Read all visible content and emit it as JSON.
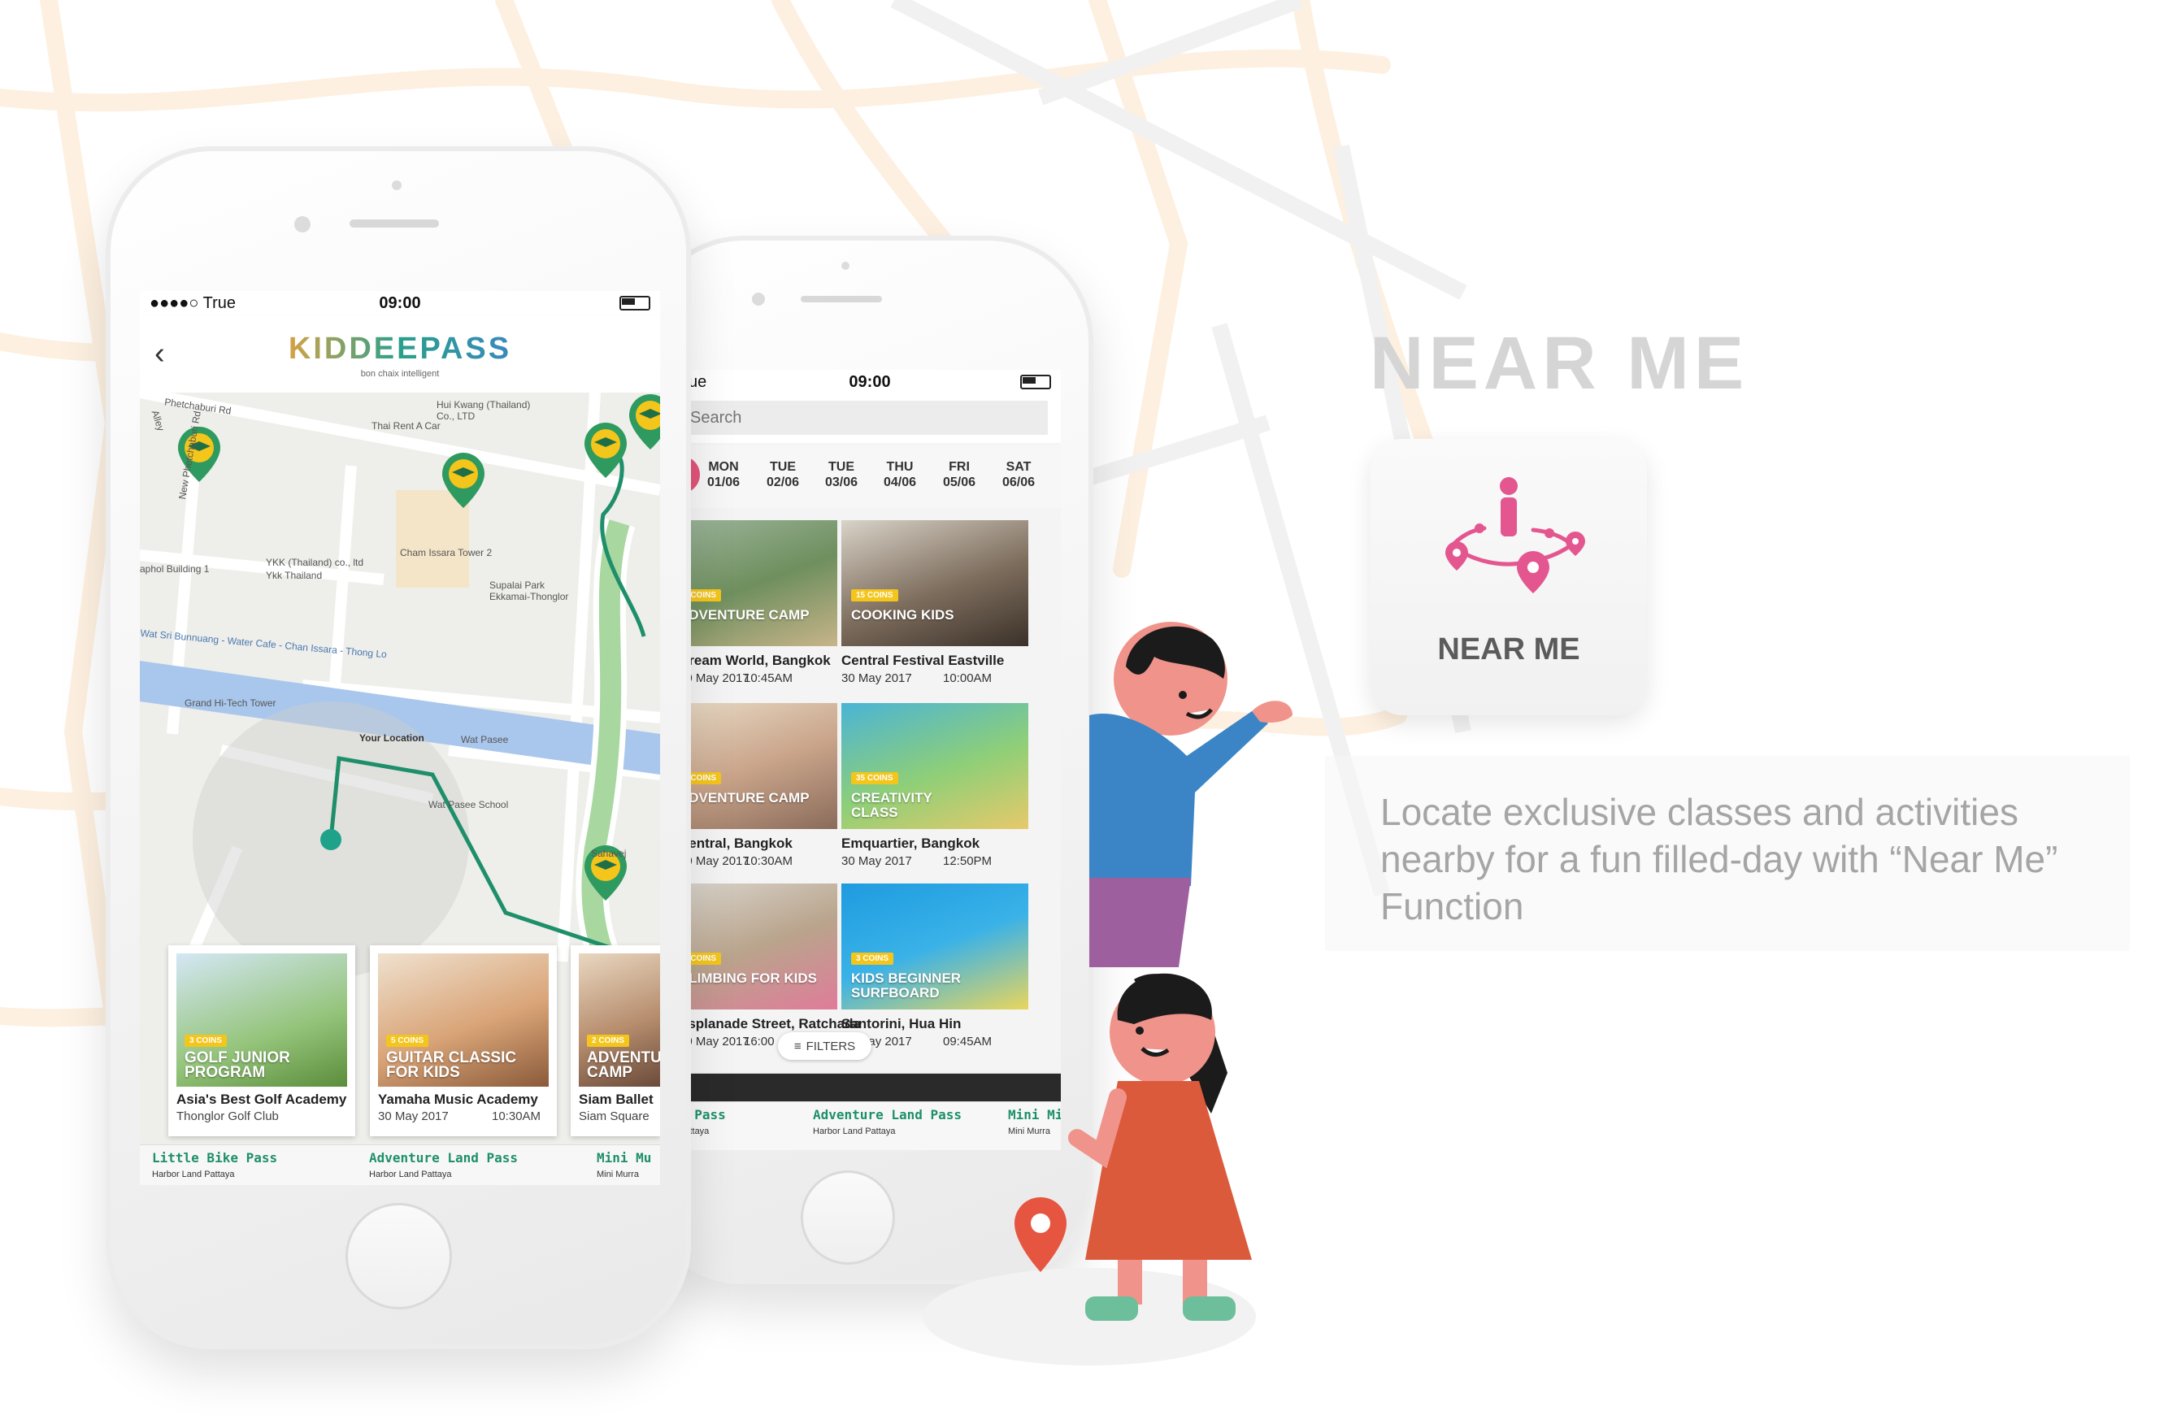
{
  "headline": "NEAR ME",
  "feature": {
    "label": "NEAR ME",
    "icon": "near-me-location-icon"
  },
  "description": "Locate exclusive classes and activities nearby for a fun filled-day with “Near Me” Function",
  "colors": {
    "brand_green": "#1e8f6a",
    "pin_green": "#2e9a5f",
    "coins_yellow": "#f4c51b",
    "near_me_pink": "#e4568f",
    "headline_gray": "#d5d5d5"
  },
  "phone_left": {
    "status": {
      "carrier": "●●●●○ True",
      "time": "09:00"
    },
    "header": {
      "logo": "KIDDEEPASS",
      "tagline": "bon chaix intelligent",
      "back_icon": "chevron-left-icon"
    },
    "map_labels": {
      "road1": "Phetchaburi Rd",
      "road2": "New Phetchaburi Rd",
      "road3": "Alley",
      "place1": "Thai Rent A Car",
      "place2": "Hui Kwang (Thailand) Co., LTD",
      "place3": "YKK (Thailand) co., ltd",
      "place4": "Ykk Thailand",
      "place5": "Cham Issara Tower 2",
      "place6": "Supalai Park Ekkamai-Thonglor",
      "place7": "Grand Hi-Tech Tower",
      "place8": "Your Location",
      "place9": "Wat Pasee",
      "place10": "Wat Pasee School",
      "place11": "aphol Building 1",
      "place12": "Wat Sri Bunnuang - Water Cafe - Chan Issara - Thong Lo",
      "place13": "Sahavej"
    },
    "cards": [
      {
        "coins": "3 COINS",
        "title": "GOLF JUNIOR PROGRAM",
        "venue": "Asia's Best Golf Academy",
        "sub": "Thonglor Golf Club"
      },
      {
        "coins": "5 COINS",
        "title": "GUITAR CLASSIC FOR KIDS",
        "venue": "Yamaha Music Academy",
        "sub": "30 May 2017",
        "time": "10:30AM"
      },
      {
        "coins": "2 COINS",
        "title": "ADVENTU CAMP",
        "venue": "Siam Ballet",
        "sub": "Siam Square"
      }
    ],
    "strip": [
      {
        "title": "Little Bike Pass",
        "sub": "Harbor Land Pattaya"
      },
      {
        "title": "Adventure Land Pass",
        "sub": "Harbor Land Pattaya"
      },
      {
        "title": "Mini Mu",
        "sub": "Mini Murra"
      }
    ]
  },
  "phone_right": {
    "status": {
      "carrier": "ue",
      "time": "09:00"
    },
    "search_placeholder": "Search",
    "days": [
      {
        "day": "MON",
        "date": "01/06"
      },
      {
        "day": "TUE",
        "date": "02/06"
      },
      {
        "day": "TUE",
        "date": "03/06"
      },
      {
        "day": "THU",
        "date": "04/06"
      },
      {
        "day": "FRI",
        "date": "05/06"
      },
      {
        "day": "SAT",
        "date": "06/06"
      }
    ],
    "grid": [
      {
        "coins": "2 COINS",
        "title": "ADVENTURE CAMP",
        "venue": "Dream World, Bangkok",
        "date": "30 May 2017",
        "time": "10:45AM"
      },
      {
        "coins": "15 COINS",
        "title": "COOKING KIDS",
        "venue": "Central Festival Eastville",
        "date": "30 May 2017",
        "time": "10:00AM"
      },
      {
        "coins": "2 COINS",
        "title": "ADVENTURE CAMP",
        "venue": "Central, Bangkok",
        "date": "30 May 2017",
        "time": "10:30AM"
      },
      {
        "coins": "35 COINS",
        "title": "CREATIVITY CLASS",
        "venue": "Emquartier, Bangkok",
        "date": "30 May 2017",
        "time": "12:50PM"
      },
      {
        "coins": "5 COINS",
        "title": "CLIMBING FOR KIDS",
        "venue": "Esplanade Street, Ratchada",
        "date": "30 May 2017",
        "time": "16:00"
      },
      {
        "coins": "3 COINS",
        "title": "KIDS BEGINNER SURFBOARD",
        "venue": "Santorini, Hua Hin",
        "date": "30 May 2017",
        "time": "09:45AM"
      }
    ],
    "filters_label": "FILTERS",
    "strip": [
      {
        "title": "e Pass",
        "sub": "Pattaya"
      },
      {
        "title": "Adventure Land Pass",
        "sub": "Harbor Land Pattaya"
      },
      {
        "title": "Mini Mi",
        "sub": "Mini Murra"
      }
    ]
  }
}
